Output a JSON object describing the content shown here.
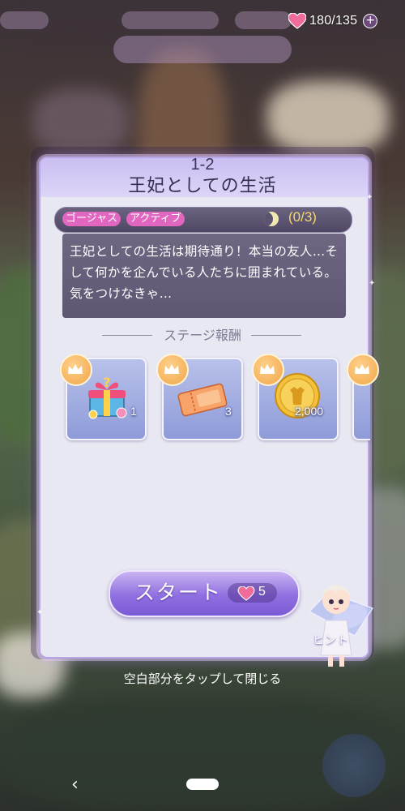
{
  "hud": {
    "stamina": "180/135",
    "plus_icon": "plus-circle-icon"
  },
  "stage": {
    "number": "1-2",
    "title": "王妃としての生活",
    "tags": [
      "ゴージャス",
      "アクティブ"
    ],
    "progress": "(0/3)",
    "description": "王妃としての生活は期待通り！本当の友人…そして何かを企んでいる人たちに囲まれている。気をつけなきゃ…"
  },
  "rewards": {
    "heading": "ステージ報酬",
    "items": [
      {
        "icon": "gift-box-icon",
        "quantity": "1"
      },
      {
        "icon": "ticket-icon",
        "quantity": "3"
      },
      {
        "icon": "gold-coin-icon",
        "quantity": "2,000"
      },
      {
        "icon": "reward-item-icon",
        "quantity": ""
      }
    ]
  },
  "start": {
    "label": "スタート",
    "cost": "5"
  },
  "hint": {
    "label": "ヒント"
  },
  "footer": {
    "close_hint": "空白部分をタップして閉じる",
    "back": "‹"
  },
  "colors": {
    "tag_pink": "#e066c0",
    "progress_gold": "#f5d86a",
    "start_purple": "#8f6fe0",
    "card_bg": "#e8e8f3"
  }
}
